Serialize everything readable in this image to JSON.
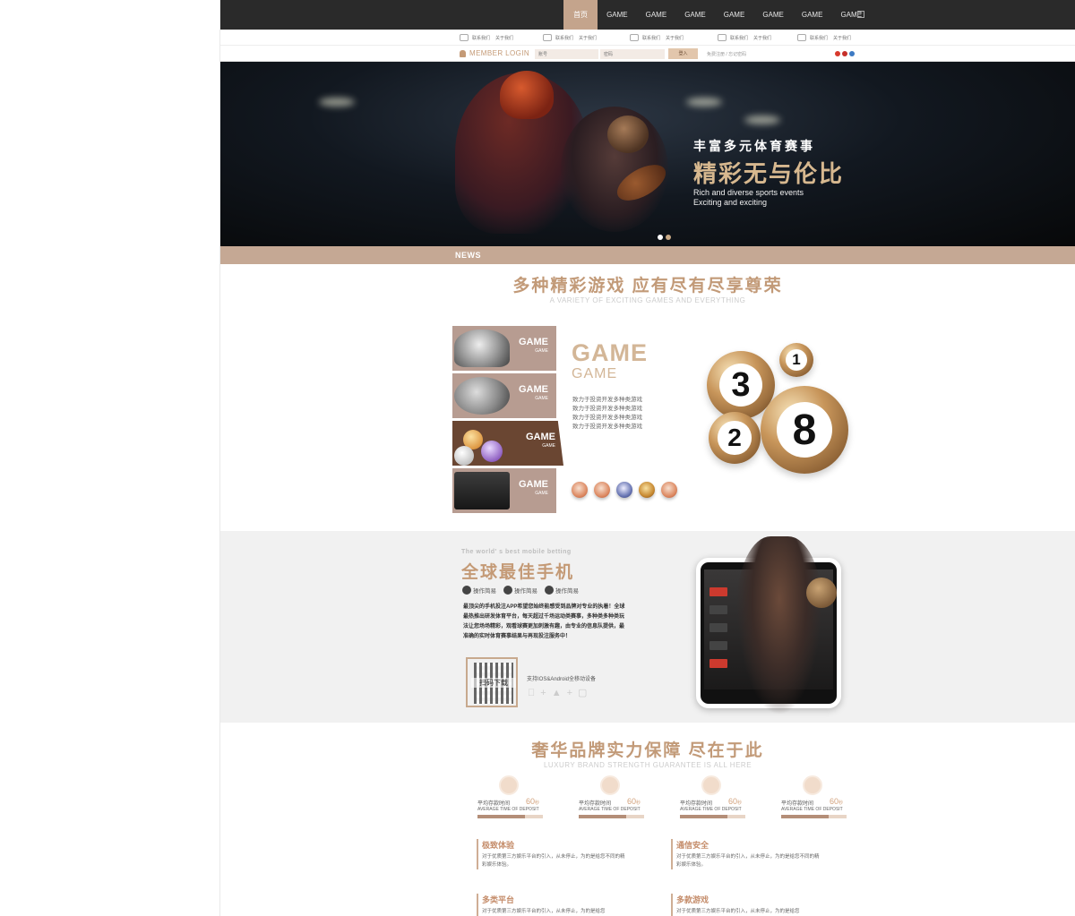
{
  "colors": {
    "accent": "#c49a76",
    "nav_bg": "#2a2a2a",
    "nav_active": "#c4a48c",
    "news_bar": "#c5a894",
    "mobile_bg": "#f1f1f1"
  },
  "nav": {
    "items": [
      "首页",
      "GAME",
      "GAME",
      "GAME",
      "GAME",
      "GAME",
      "GAME",
      "GAME"
    ],
    "icon": "plus-icon"
  },
  "quick_links": [
    {
      "icon": "handshake-icon",
      "a": "联系我们",
      "b": "关于我们"
    },
    {
      "icon": "hand-icon",
      "a": "联系我们",
      "b": "关于我们"
    },
    {
      "icon": "shake-hands-icon",
      "a": "联系我们",
      "b": "关于我们"
    },
    {
      "icon": "diamond-icon",
      "a": "联系我们",
      "b": "关于我们"
    },
    {
      "icon": "car-icon",
      "a": "联系我们",
      "b": "关于我们"
    }
  ],
  "login": {
    "title": "MEMBER LOGIN",
    "username_placeholder": "账号",
    "password_placeholder": "密码",
    "submit": "登入",
    "links": "免费注册 / 忘记密码"
  },
  "hero": {
    "line1": "丰富多元体育赛事",
    "line2": "精彩无与伦比",
    "line3": "Rich and diverse sports events",
    "line4": "Exciting and exciting"
  },
  "news": {
    "label": "NEWS"
  },
  "games": {
    "title": "多种精彩游戏 应有尽有尽享尊荣",
    "subtitle": "A VARIETY OF EXCITING GAMES AND EVERYTHING",
    "tiles": [
      {
        "label": "GAME",
        "sub": "GAME"
      },
      {
        "label": "GAME",
        "sub": "GAME"
      },
      {
        "label": "GAME",
        "sub": "GAME"
      },
      {
        "label": "GAME",
        "sub": "GAME"
      }
    ],
    "heading": "GAME",
    "heading2": "GAME",
    "desc": [
      "致力于投资开发多种类游戏",
      "致力于投资开发多种类游戏",
      "致力于投资开发多种类游戏",
      "致力于投资开发多种类游戏"
    ],
    "balls": [
      "3",
      "1",
      "2",
      "8"
    ]
  },
  "mobile": {
    "en": "The world' s best mobile betting",
    "title": "全球最佳手机",
    "features": [
      "操作简易",
      "操作简易",
      "操作简易"
    ],
    "paragraph": "最顶尖的手机投注APP希望您始终能感受到品牌对专业的执着！全球最热推出研发体育平台，每天超过千场运动类赛事，多种类多种类玩法让您场场精彩，观看球赛更加刺激有趣，由专业的信息队提供，最准确的实时体育赛事结果与再现投注服务中！",
    "qr_label": "扫码下载",
    "support": "支持IOS&Android全移动设备"
  },
  "lux": {
    "title": "奢华品牌实力保障 尽在于此",
    "subtitle": "LUXURY BRAND STRENGTH GUARANTEE IS ALL HERE",
    "stats": [
      {
        "label": "平均存款时间",
        "value": "60",
        "unit": "秒",
        "en": "AVERAGE TIME OF DEPOSIT",
        "progress": 0.72
      },
      {
        "label": "平均存款时间",
        "value": "60",
        "unit": "秒",
        "en": "AVERAGE TIME OF DEPOSIT",
        "progress": 0.72
      },
      {
        "label": "平均存款时间",
        "value": "60",
        "unit": "秒",
        "en": "AVERAGE TIME OF DEPOSIT",
        "progress": 0.72
      },
      {
        "label": "平均存款时间",
        "value": "60",
        "unit": "秒",
        "en": "AVERAGE TIME OF DEPOSIT",
        "progress": 0.72
      }
    ],
    "features": [
      {
        "title": "极致体验",
        "text": "对于优质第三方娱乐平台的引入，从未停止，为的是给您不同的精彩娱乐体验。"
      },
      {
        "title": "通信安全",
        "text": "对于优质第三方娱乐平台的引入，从未停止，为的是给您不同的精彩娱乐体验。"
      },
      {
        "title": "多类平台",
        "text": "对于优质第三方娱乐平台的引入，从未停止，为的是给您"
      },
      {
        "title": "多款游戏",
        "text": "对于优质第三方娱乐平台的引入，从未停止，为的是给您"
      }
    ]
  }
}
